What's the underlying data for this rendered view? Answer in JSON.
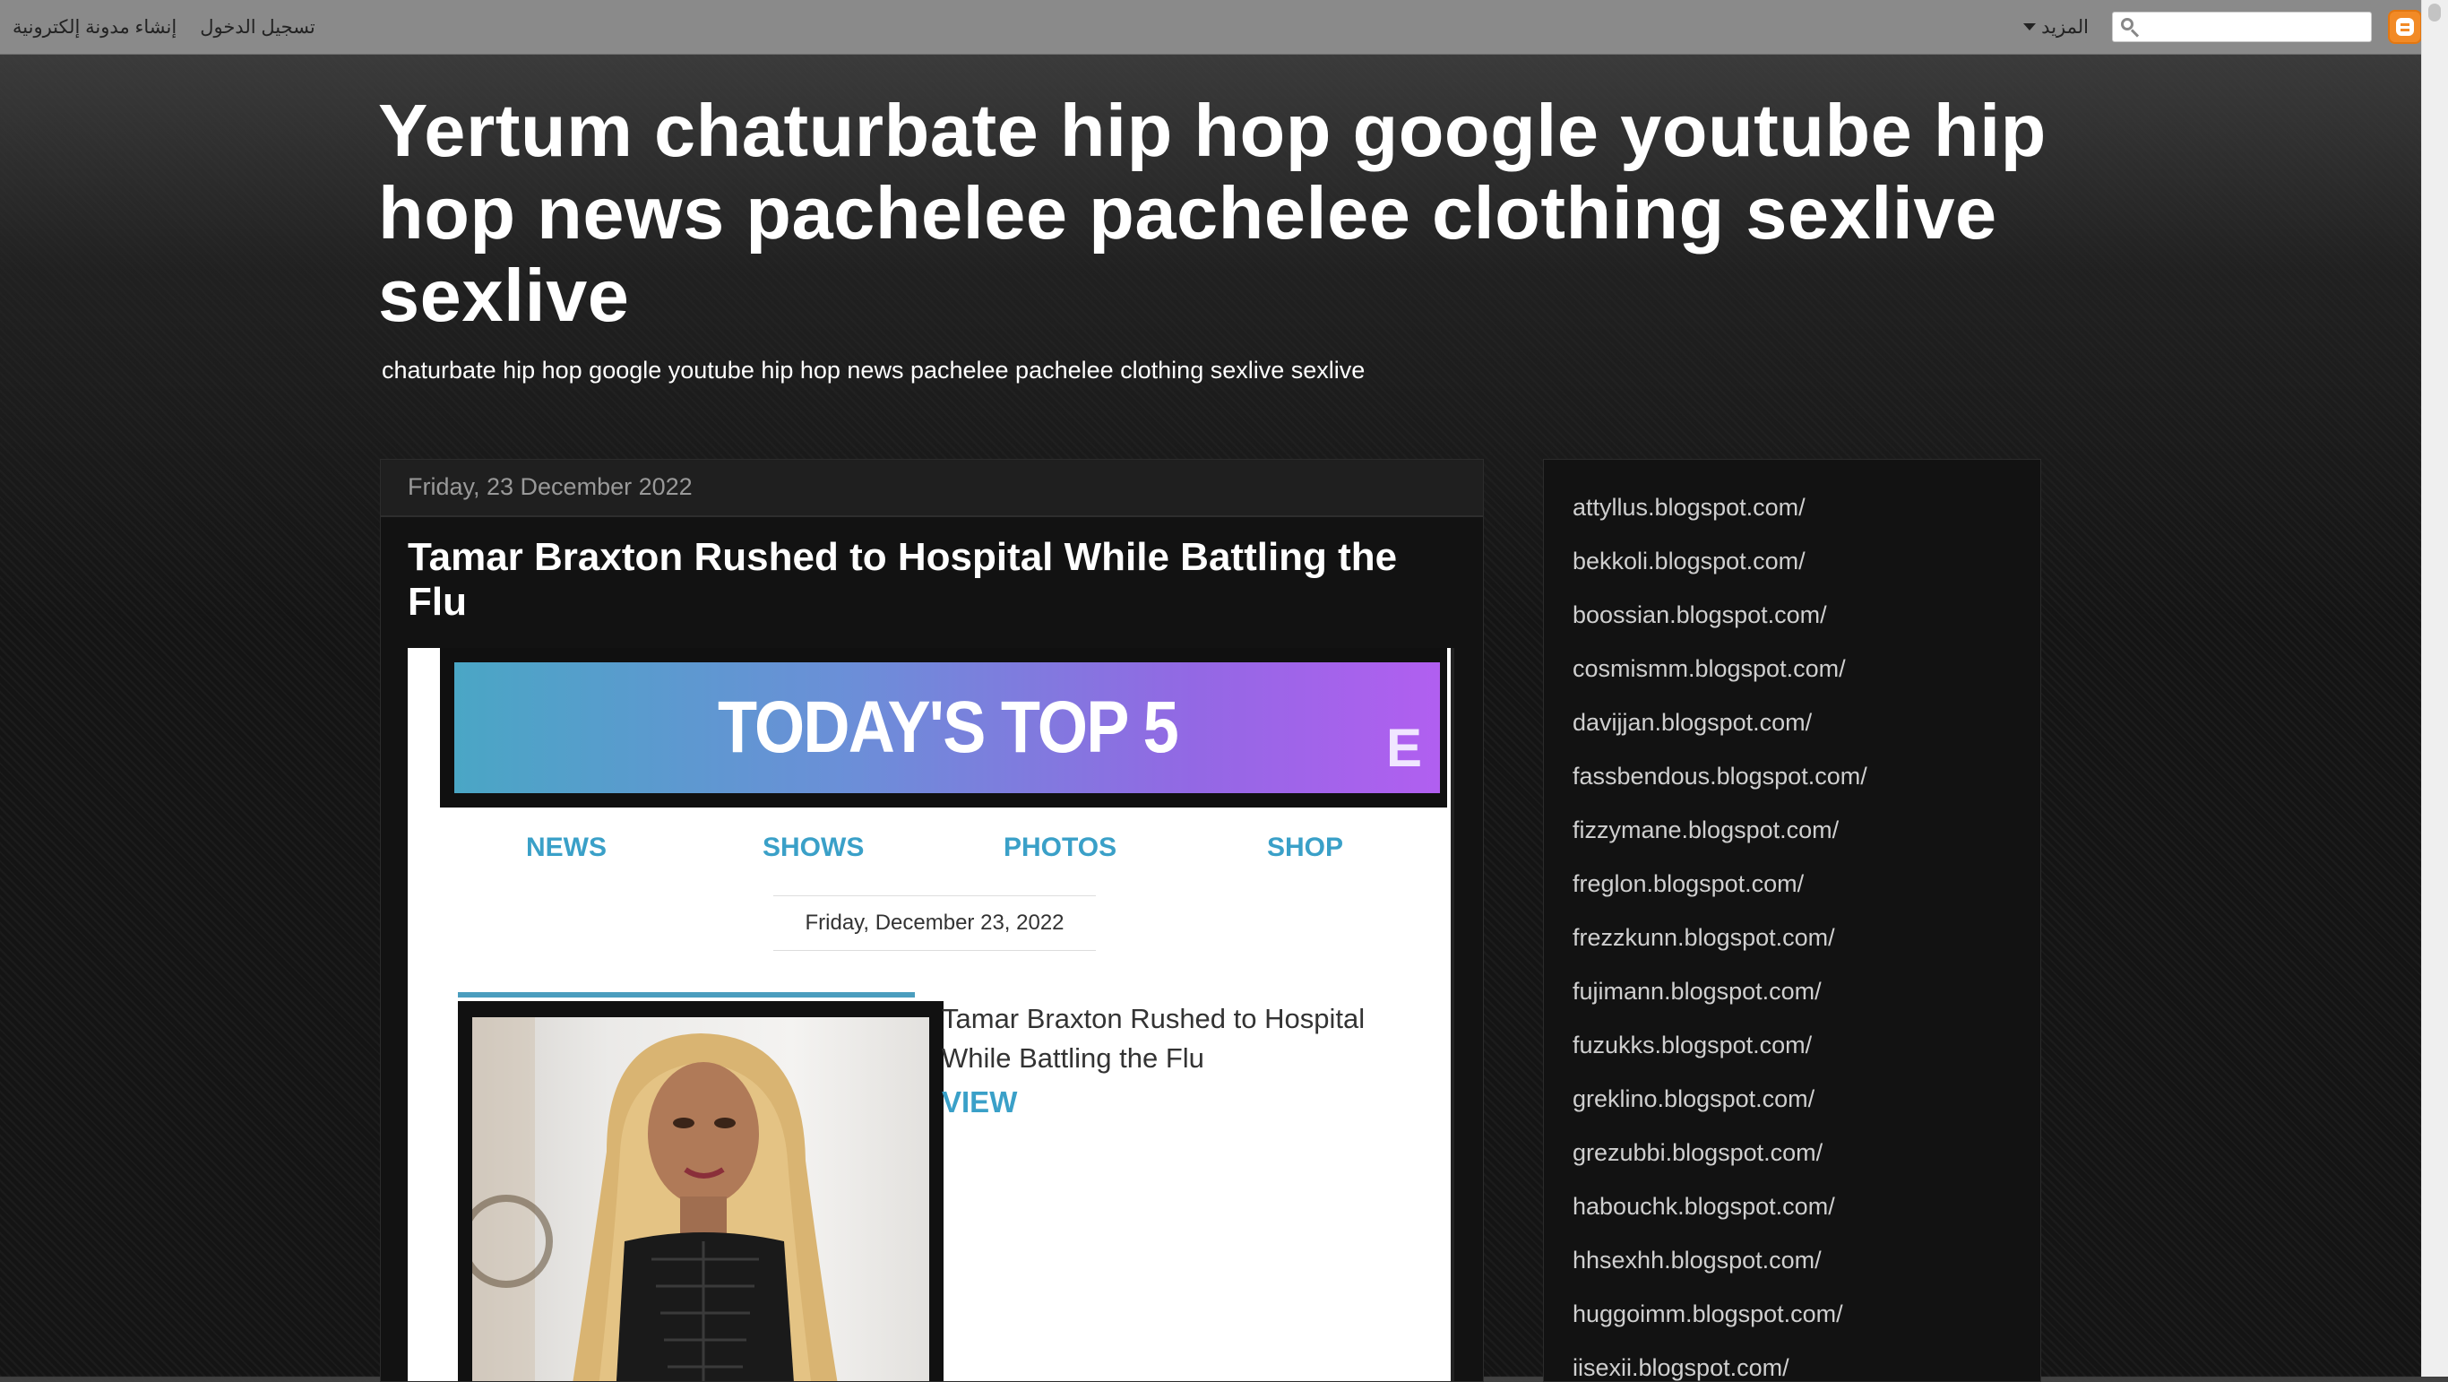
{
  "navbar": {
    "links": [
      "تسجيل الدخول",
      "إنشاء مدونة إلكترونية"
    ],
    "more_label": "المزيد",
    "search_placeholder": ""
  },
  "blog": {
    "title": "Yertum chaturbate hip hop google youtube hip hop news pachelee pachelee clothing sexlive sexlive",
    "description": "chaturbate hip hop google youtube hip hop news pachelee pachelee clothing sexlive sexlive"
  },
  "post": {
    "date_header": "Friday, 23 December 2022",
    "title": "Tamar Braxton Rushed to Hospital While Battling the Flu",
    "banner_text": "TODAY'S TOP 5",
    "banner_logo": "E",
    "tabs": [
      "NEWS",
      "SHOWS",
      "PHOTOS",
      "SHOP"
    ],
    "inner_date": "Friday, December 23, 2022",
    "story_title": "Tamar Braxton Rushed to Hospital While Battling the Flu",
    "view_label": "VIEW"
  },
  "sidebar": {
    "links": [
      "attyllus.blogspot.com/",
      "bekkoli.blogspot.com/",
      "boossian.blogspot.com/",
      "cosmismm.blogspot.com/",
      "davijjan.blogspot.com/",
      "fassbendous.blogspot.com/",
      "fizzymane.blogspot.com/",
      "freglon.blogspot.com/",
      "frezzkunn.blogspot.com/",
      "fujimann.blogspot.com/",
      "fuzukks.blogspot.com/",
      "greklino.blogspot.com/",
      "grezubbi.blogspot.com/",
      "habouchk.blogspot.com/",
      "hhsexhh.blogspot.com/",
      "huggoimm.blogspot.com/",
      "iisexii.blogspot.com/"
    ]
  },
  "colors": {
    "accent_link": "#3aa0c8",
    "navbar_bg": "#8a8a8a",
    "blogger_orange": "#f28a26"
  }
}
